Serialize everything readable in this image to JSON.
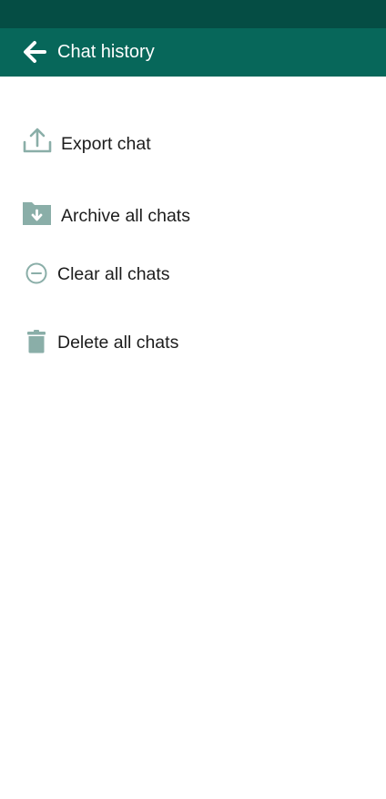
{
  "header": {
    "title": "Chat history",
    "back_icon": "arrow-left-icon"
  },
  "menu": {
    "items": [
      {
        "label": "Export chat",
        "icon": "upload-icon"
      },
      {
        "label": "Archive all chats",
        "icon": "archive-folder-icon"
      },
      {
        "label": "Clear all chats",
        "icon": "minus-circle-icon"
      },
      {
        "label": "Delete all chats",
        "icon": "trash-icon"
      }
    ]
  },
  "colors": {
    "status_bar": "#054d44",
    "app_bar": "#07675a",
    "icon": "#8aaea8",
    "text": "#1c1c1c"
  }
}
